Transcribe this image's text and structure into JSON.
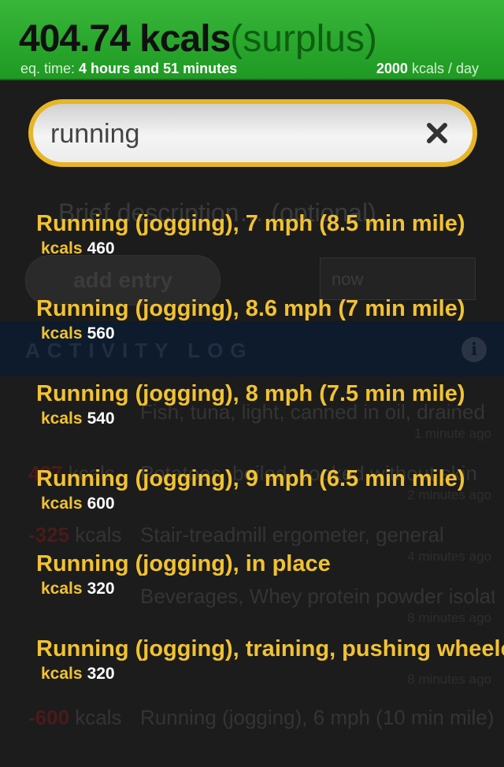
{
  "summary": {
    "kcals": "404.74 kcals",
    "status": "(surplus)",
    "eq_label": "eq. time:",
    "eq_value": "4 hours and 51 minutes",
    "daily_value": "2000",
    "daily_unit": "kcals / day"
  },
  "search": {
    "value": "running",
    "clear_icon": "close-x-icon"
  },
  "suggestions": [
    {
      "name": "Running (jogging), 7 mph (8.5 min mile)",
      "kcal_label": "kcals",
      "kcal": "460"
    },
    {
      "name": "Running (jogging), 8.6 mph (7 min mile)",
      "kcal_label": "kcals",
      "kcal": "560"
    },
    {
      "name": "Running (jogging), 8 mph (7.5 min mile)",
      "kcal_label": "kcals",
      "kcal": "540"
    },
    {
      "name": "Running (jogging), 9 mph (6.5 min mile)",
      "kcal_label": "kcals",
      "kcal": "600"
    },
    {
      "name": "Running (jogging), in place",
      "kcal_label": "kcals",
      "kcal": "320"
    },
    {
      "name": "Running (jogging), training, pushing wheelchair",
      "kcal_label": "kcals",
      "kcal": "320"
    }
  ],
  "background": {
    "description_placeholder": "Brief description… (optional)",
    "add_entry": "add entry",
    "time_value": "now",
    "section_title": "ACTIVITY LOG",
    "info_icon": "info-icon",
    "log": [
      {
        "kcal": "",
        "unit": "",
        "food": "Fish, tuna, light, canned in oil, drained",
        "ago": "1 minute ago"
      },
      {
        "kcal": "487",
        "unit": "kcals",
        "food": "Potatoes, boiled, cooked without skin",
        "ago": "2 minutes ago"
      },
      {
        "kcal": "-325",
        "unit": "kcals",
        "food": "Stair-treadmill ergometer, general",
        "ago": "4 minutes ago"
      },
      {
        "kcal": "",
        "unit": "",
        "food": "Beverages, Whey protein powder isolate",
        "ago": "8 minutes ago"
      },
      {
        "kcal": "",
        "unit": "",
        "food": "",
        "ago": "8 minutes ago"
      },
      {
        "kcal": "-600",
        "unit": "kcals",
        "food": "Running (jogging), 6 mph (10 min mile)",
        "ago": ""
      }
    ]
  },
  "colors": {
    "accent_green": "#2aa82d",
    "suggestion_gold": "#f1c232",
    "search_border": "#e8b525"
  }
}
